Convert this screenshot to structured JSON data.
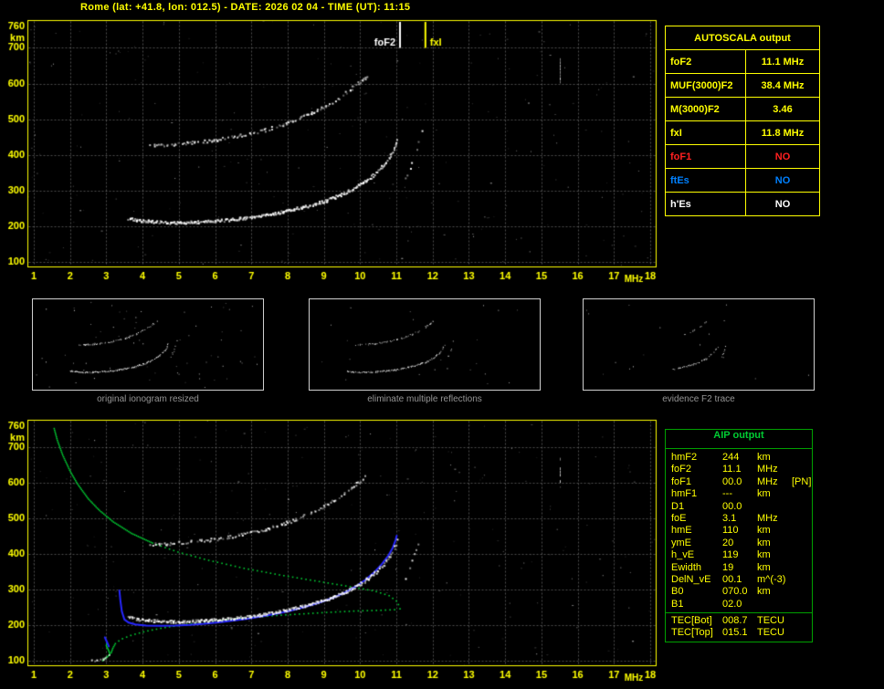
{
  "title": "Rome (lat: +41.8, lon: 012.5) - DATE: 2026 02 04 - TIME (UT): 11:15",
  "colors": {
    "accent_yellow": "#ffff00",
    "aip_green": "#00a000",
    "profile_green": "#00cc33",
    "fit_blue": "#2626ff",
    "no_red": "#ff2020",
    "no_blue": "#0080ff",
    "grid_gray": "#8c8c8c",
    "caption_gray": "#949494"
  },
  "autoscala_table": {
    "header": "AUTOSCALA output",
    "rows": [
      {
        "label": "foF2",
        "value": "11.1 MHz",
        "color": "#ffff00"
      },
      {
        "label": "MUF(3000)F2",
        "value": "38.4 MHz",
        "color": "#ffff00"
      },
      {
        "label": "M(3000)F2",
        "value": "3.46",
        "color": "#ffff00"
      },
      {
        "label": "fxI",
        "value": "11.8 MHz",
        "color": "#ffff00"
      },
      {
        "label": "foF1",
        "value": "NO",
        "color": "#ff2020"
      },
      {
        "label": "ftEs",
        "value": "NO",
        "color": "#0080ff"
      },
      {
        "label": "h'Es",
        "value": "NO",
        "color": "#ffffff"
      }
    ]
  },
  "aip_table": {
    "header": "AIP output",
    "rows": [
      {
        "label": "hmF2",
        "value": "244",
        "unit": "km",
        "note": ""
      },
      {
        "label": "foF2",
        "value": "11.1",
        "unit": "MHz",
        "note": ""
      },
      {
        "label": "foF1",
        "value": "00.0",
        "unit": "MHz",
        "note": "[PN]"
      },
      {
        "label": "hmF1",
        "value": "---",
        "unit": "km",
        "note": ""
      },
      {
        "label": "D1",
        "value": "00.0",
        "unit": "",
        "note": ""
      },
      {
        "label": "foE",
        "value": "3.1",
        "unit": "MHz",
        "note": ""
      },
      {
        "label": "hmE",
        "value": "110",
        "unit": "km",
        "note": ""
      },
      {
        "label": "ymE",
        "value": "20",
        "unit": "km",
        "note": ""
      },
      {
        "label": "h_vE",
        "value": "119",
        "unit": "km",
        "note": ""
      },
      {
        "label": "Ewidth",
        "value": "19",
        "unit": "km",
        "note": ""
      },
      {
        "label": "DelN_vE",
        "value": "00.1",
        "unit": "m^(-3)",
        "note": ""
      },
      {
        "label": "B0",
        "value": "070.0",
        "unit": "km",
        "note": ""
      },
      {
        "label": "B1",
        "value": "02.0",
        "unit": "",
        "note": ""
      }
    ],
    "tec_rows": [
      {
        "label": "TEC[Bot]",
        "value": "008.7",
        "unit": "TECU"
      },
      {
        "label": "TEC[Top]",
        "value": "015.1",
        "unit": "TECU"
      }
    ]
  },
  "thumbnails": [
    {
      "caption": "original ionogram resized",
      "series_keep": [
        0.78,
        0.45,
        0.55
      ],
      "series_fmin": [
        3.6,
        4.2,
        11.25
      ],
      "noise": 65
    },
    {
      "caption": "eliminate multiple reflections",
      "series_keep": [
        0.72,
        0.38,
        0.5
      ],
      "series_fmin": [
        3.6,
        4.2,
        11.25
      ],
      "noise": 22
    },
    {
      "caption": "evidence F2 trace",
      "series_keep": [
        0.5,
        0.22,
        0.55
      ],
      "series_fmin": [
        7.5,
        8.2,
        11.25
      ],
      "noise": 16
    }
  ],
  "chart_data": [
    {
      "id": "top",
      "type": "scatter",
      "description": "vertical-incidence ionogram with autoscaled characteristics",
      "xlabel": "MHz",
      "ylabel": "km",
      "xlim": [
        1,
        18
      ],
      "ylim": [
        100,
        760
      ],
      "xticks": [
        1,
        2,
        3,
        4,
        5,
        6,
        7,
        8,
        9,
        10,
        11,
        12,
        13,
        14,
        15,
        16,
        17,
        18
      ],
      "yticks": [
        760,
        700,
        600,
        500,
        400,
        300,
        200,
        100
      ],
      "markers": [
        {
          "label": "foF2",
          "freq": 11.1,
          "color": "#ffffff",
          "side": "left"
        },
        {
          "label": "fxI",
          "freq": 11.8,
          "color": "#ffff00",
          "side": "right"
        }
      ],
      "noise_seed": 7,
      "noise_count": 240,
      "artifacts": [
        {
          "f": 15.5,
          "km_from": 608,
          "km_to": 672
        }
      ],
      "series": [
        {
          "name": "F2 trace 1st reflection",
          "weight": "strong",
          "points": [
            [
              3.6,
              224
            ],
            [
              3.8,
              219
            ],
            [
              4.0,
              216
            ],
            [
              4.3,
              214
            ],
            [
              4.6,
              212
            ],
            [
              5.0,
              212
            ],
            [
              5.4,
              213
            ],
            [
              5.8,
              215
            ],
            [
              6.2,
              218
            ],
            [
              6.6,
              222
            ],
            [
              7.0,
              227
            ],
            [
              7.4,
              233
            ],
            [
              7.8,
              241
            ],
            [
              8.2,
              250
            ],
            [
              8.6,
              260
            ],
            [
              9.0,
              272
            ],
            [
              9.3,
              283
            ],
            [
              9.6,
              296
            ],
            [
              9.9,
              312
            ],
            [
              10.1,
              325
            ],
            [
              10.3,
              340
            ],
            [
              10.5,
              358
            ],
            [
              10.65,
              374
            ],
            [
              10.8,
              394
            ],
            [
              10.9,
              413
            ],
            [
              10.98,
              432
            ],
            [
              11.03,
              450
            ]
          ]
        },
        {
          "name": "F2 trace 2nd reflection",
          "weight": "medium",
          "points": [
            [
              4.2,
              428
            ],
            [
              4.7,
              431
            ],
            [
              5.2,
              435
            ],
            [
              5.7,
              440
            ],
            [
              6.2,
              447
            ],
            [
              6.7,
              456
            ],
            [
              7.2,
              467
            ],
            [
              7.7,
              481
            ],
            [
              8.2,
              499
            ],
            [
              8.7,
              521
            ],
            [
              9.1,
              543
            ],
            [
              9.5,
              568
            ],
            [
              9.8,
              592
            ],
            [
              10.05,
              612
            ],
            [
              10.2,
              625
            ]
          ]
        },
        {
          "name": "F2 X-mode asymptote",
          "weight": "tip",
          "points": [
            [
              11.25,
              335
            ],
            [
              11.35,
              360
            ],
            [
              11.45,
              390
            ],
            [
              11.55,
              422
            ],
            [
              11.62,
              450
            ],
            [
              11.68,
              470
            ]
          ]
        }
      ]
    },
    {
      "id": "bot",
      "type": "scatter",
      "description": "ionogram with AIP electron density profile and fitted trace",
      "xlabel": "MHz",
      "ylabel": "km",
      "xlim": [
        1,
        18
      ],
      "ylim": [
        100,
        760
      ],
      "xticks": [
        1,
        2,
        3,
        4,
        5,
        6,
        7,
        8,
        9,
        10,
        11,
        12,
        13,
        14,
        15,
        16,
        17,
        18
      ],
      "yticks": [
        760,
        700,
        600,
        500,
        400,
        300,
        200,
        100
      ],
      "series_from": 0,
      "noise_seed": 13,
      "noise_count": 240,
      "artifacts": [
        {
          "f": 15.5,
          "km_from": 608,
          "km_to": 672
        }
      ],
      "extra_series": [
        {
          "name": "E trace",
          "weight": "tip",
          "points": [
            [
              2.6,
              102
            ],
            [
              2.75,
              104
            ],
            [
              2.9,
              107
            ],
            [
              3.02,
              112
            ],
            [
              3.12,
              121
            ]
          ]
        }
      ],
      "profile": {
        "color": "#00cc33",
        "topside": [
          [
            1.55,
            758
          ],
          [
            1.65,
            720
          ],
          [
            1.8,
            678
          ],
          [
            2.0,
            634
          ],
          [
            2.2,
            598
          ],
          [
            2.5,
            556
          ],
          [
            2.8,
            524
          ],
          [
            3.2,
            490
          ],
          [
            3.7,
            458
          ],
          [
            4.3,
            430
          ],
          [
            5.0,
            405
          ],
          [
            5.8,
            383
          ],
          [
            6.8,
            360
          ],
          [
            7.8,
            341
          ],
          [
            8.8,
            324
          ],
          [
            9.8,
            307
          ],
          [
            10.4,
            296
          ],
          [
            10.8,
            283
          ],
          [
            11.0,
            268
          ],
          [
            11.08,
            254
          ],
          [
            11.1,
            246
          ]
        ],
        "bottomside": [
          [
            3.12,
            118
          ],
          [
            3.18,
            135
          ],
          [
            3.25,
            148
          ],
          [
            3.4,
            160
          ],
          [
            3.7,
            172
          ],
          [
            4.1,
            183
          ],
          [
            4.6,
            193
          ],
          [
            5.2,
            202
          ],
          [
            5.9,
            211
          ],
          [
            6.7,
            219
          ],
          [
            7.5,
            226
          ],
          [
            8.3,
            231
          ],
          [
            9.1,
            236
          ],
          [
            9.9,
            240
          ],
          [
            10.6,
            242
          ],
          [
            11.05,
            244
          ]
        ],
        "evalley": [
          [
            2.9,
            100
          ],
          [
            2.96,
            106
          ],
          [
            3.04,
            112
          ],
          [
            3.1,
            118
          ],
          [
            3.06,
            130
          ],
          [
            3.0,
            142
          ],
          [
            3.02,
            152
          ]
        ]
      },
      "fit": {
        "color": "#2626ff",
        "points": [
          [
            3.36,
            298
          ],
          [
            3.39,
            268
          ],
          [
            3.43,
            238
          ],
          [
            3.5,
            216
          ],
          [
            3.62,
            207
          ],
          [
            3.8,
            202
          ],
          [
            4.1,
            199
          ],
          [
            4.5,
            198
          ],
          [
            4.9,
            199
          ],
          [
            5.3,
            201
          ],
          [
            5.7,
            204
          ],
          [
            6.1,
            208
          ],
          [
            6.5,
            213
          ],
          [
            6.9,
            218
          ],
          [
            7.3,
            225
          ],
          [
            7.7,
            232
          ],
          [
            8.1,
            241
          ],
          [
            8.5,
            252
          ],
          [
            8.9,
            264
          ],
          [
            9.3,
            279
          ],
          [
            9.6,
            293
          ],
          [
            9.9,
            310
          ],
          [
            10.15,
            328
          ],
          [
            10.4,
            350
          ],
          [
            10.6,
            372
          ],
          [
            10.78,
            396
          ],
          [
            10.9,
            418
          ],
          [
            10.98,
            440
          ],
          [
            11.01,
            452
          ]
        ],
        "e_segment": [
          [
            2.96,
            166
          ],
          [
            3.02,
            152
          ],
          [
            3.07,
            140
          ]
        ]
      }
    }
  ]
}
